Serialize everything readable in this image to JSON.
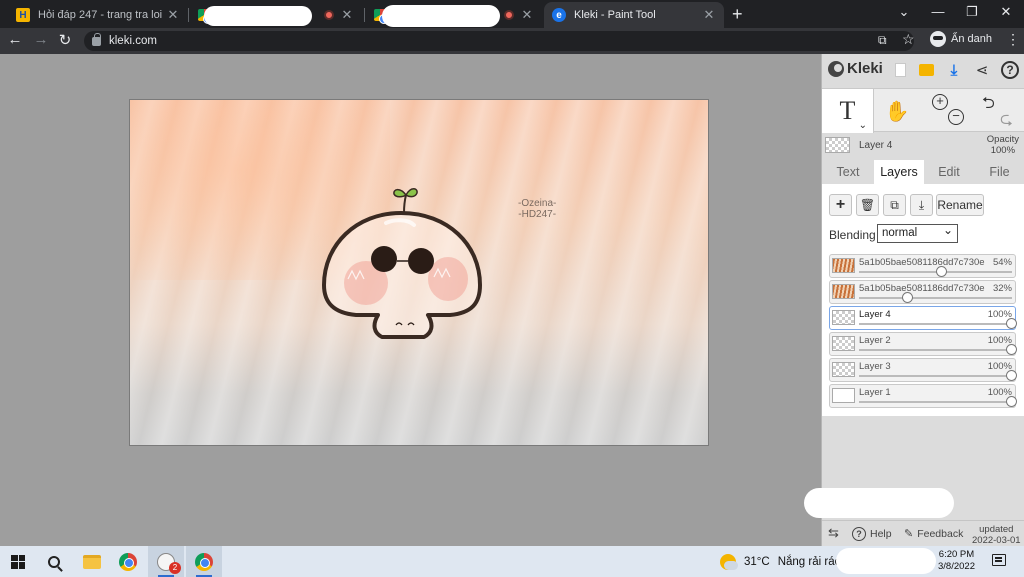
{
  "browser": {
    "tabs": [
      {
        "title": "Hỏi đáp 247 - trang tra loi",
        "favicon": "hoidap-h-icon"
      },
      {
        "title": "",
        "favicon": "chrome-icon",
        "redacted": true,
        "recording": true
      },
      {
        "title": "",
        "favicon": "chrome-icon",
        "redacted": true,
        "recording": true
      },
      {
        "title": "Kleki - Paint Tool",
        "favicon": "kleki-icon",
        "active": true
      }
    ],
    "url": "kleki.com",
    "profile_label": "Ẩn danh"
  },
  "canvas": {
    "watermark_line1": "-Ozeina-",
    "watermark_line2": "-HD247-"
  },
  "panel": {
    "brand": "Kleki",
    "current_layer": {
      "name": "Layer 4",
      "opacity_label": "Opacity",
      "opacity_value": "100%"
    },
    "tabs": [
      "Text",
      "Layers",
      "Edit",
      "File"
    ],
    "active_tab": "Layers",
    "layer_actions": {
      "rename_label": "Rename"
    },
    "blending": {
      "label": "Blending",
      "value": "normal"
    },
    "layers": [
      {
        "name": "5a1b05bae5081186dd7c730e",
        "opacity": "54%",
        "opacity_value": 0.54,
        "thumb": "stripe"
      },
      {
        "name": "5a1b05bae5081186dd7c730e",
        "opacity": "32%",
        "opacity_value": 0.32,
        "thumb": "stripe"
      },
      {
        "name": "Layer 4",
        "opacity": "100%",
        "opacity_value": 1.0,
        "thumb": "checker",
        "selected": true
      },
      {
        "name": "Layer 2",
        "opacity": "100%",
        "opacity_value": 1.0,
        "thumb": "checker"
      },
      {
        "name": "Layer 3",
        "opacity": "100%",
        "opacity_value": 1.0,
        "thumb": "checker"
      },
      {
        "name": "Layer 1",
        "opacity": "100%",
        "opacity_value": 1.0,
        "thumb": "white"
      }
    ],
    "footer": {
      "help": "Help",
      "feedback": "Feedback",
      "updated_label": "updated",
      "updated_date": "2022-03-01"
    }
  },
  "taskbar": {
    "weather_temp": "31°C",
    "weather_text": "Nắng rải rác",
    "time": "6:20 PM",
    "date": "3/8/2022",
    "kleki_badge": "2"
  }
}
